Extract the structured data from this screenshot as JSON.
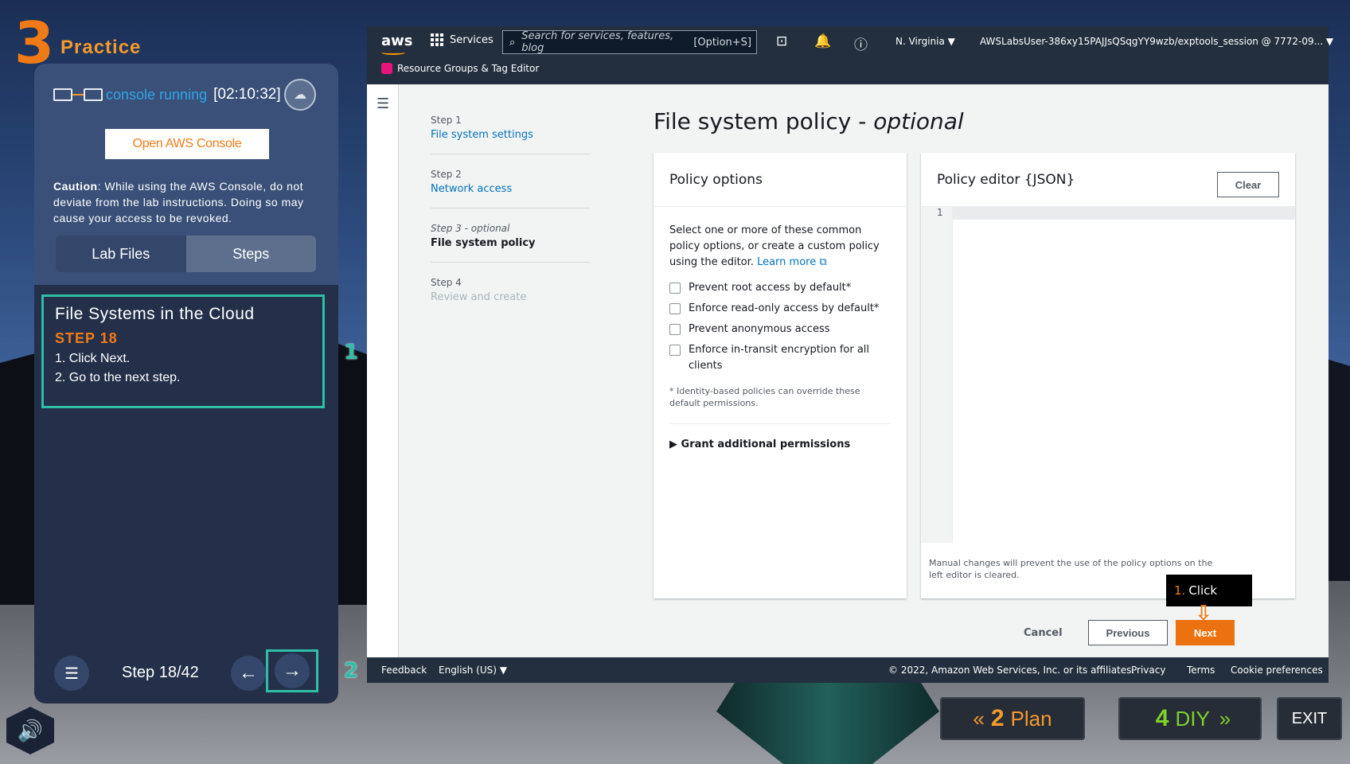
{
  "practice": {
    "number": "3",
    "label": "Practice"
  },
  "console": {
    "status": "console running",
    "timer": "[02:10:32]",
    "open_button": "Open AWS Console"
  },
  "caution": {
    "label": "Caution",
    "text": ": While using the AWS Console, do not deviate from the lab instructions. Doing so may cause your access to be revoked."
  },
  "tabs": [
    {
      "label": "Lab Files"
    },
    {
      "label": "Steps"
    }
  ],
  "step_card": {
    "title": "File Systems in the Cloud",
    "step": "STEP 18",
    "lines": [
      "1. Click Next.",
      "2. Go to the next step."
    ]
  },
  "markers": {
    "one": "1",
    "two": "2"
  },
  "nav": {
    "count": "Step 18/42"
  },
  "aws": {
    "logo": "aws",
    "services": "Services",
    "search_placeholder": "Search for services, features, blog",
    "search_shortcut": "[Option+S]",
    "region": "N. Virginia ▼",
    "account": "AWSLabsUser-386xy15PAJJsQSqgYY9wzb/exptools_session @ 7772-09... ▼",
    "resource_groups": "Resource Groups & Tag Editor",
    "wizard": [
      {
        "label": "Step 1",
        "name": "File system settings"
      },
      {
        "label": "Step 2",
        "name": "Network access"
      },
      {
        "label": "Step 3 - optional",
        "name": "File system policy"
      },
      {
        "label": "Step 4",
        "name": "Review and create"
      }
    ],
    "page_title": "File system policy - ",
    "page_title_italic": "optional",
    "policy_options": {
      "header": "Policy options",
      "intro": "Select one or more of these common policy options, or create a custom policy using the editor.",
      "learn_more": "Learn more",
      "checkboxes": [
        "Prevent root access by default*",
        "Enforce read-only access by default*",
        "Prevent anonymous access",
        "Enforce in-transit encryption for all clients"
      ],
      "footnote": "* Identity-based policies can override these default permissions.",
      "grant": "Grant additional permissions"
    },
    "policy_editor": {
      "header": "Policy editor {JSON}",
      "clear": "Clear",
      "line": "1",
      "note": "Manual changes will prevent the use of the policy options on the left editor is cleared."
    },
    "buttons": {
      "cancel": "Cancel",
      "previous": "Previous",
      "next": "Next"
    },
    "tooltip": {
      "num": "1.",
      "text": "Click"
    },
    "footer": {
      "feedback": "Feedback",
      "language": "English (US) ▼",
      "copyright": "© 2022, Amazon Web Services, Inc. or its affiliates.",
      "privacy": "Privacy",
      "terms": "Terms",
      "cookies": "Cookie preferences"
    }
  },
  "game_buttons": {
    "plan_num": "2",
    "plan": "Plan",
    "diy_num": "4",
    "diy": "DIY",
    "exit": "EXIT"
  },
  "colors": {
    "accent": "#f07b16",
    "teal": "#2fbfa6",
    "aws_orange": "#ec7211",
    "aws_dark": "#232f3e"
  }
}
